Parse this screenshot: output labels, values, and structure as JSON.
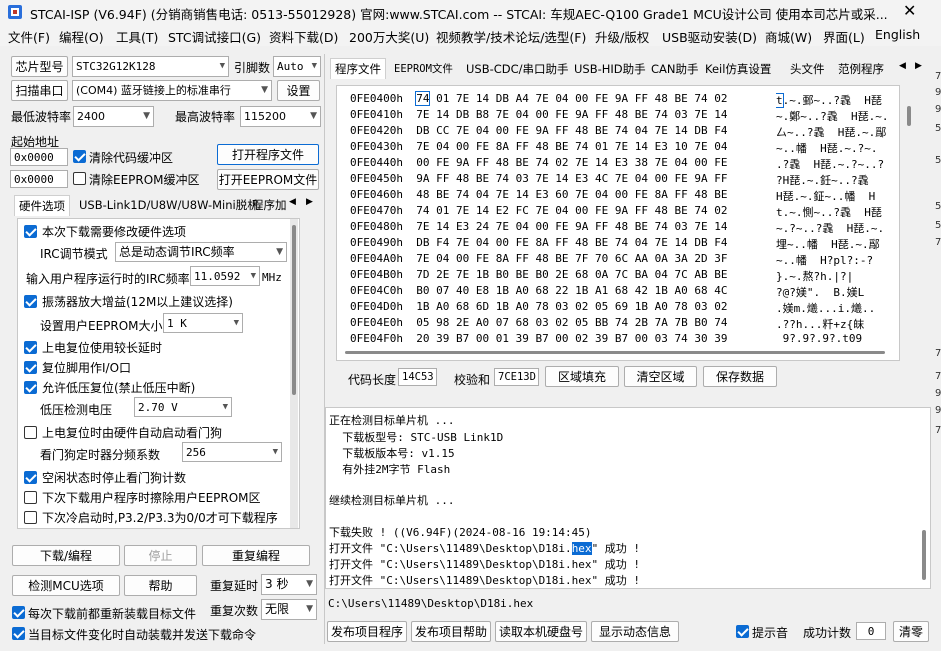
{
  "titlebar": {
    "title": "STCAI-ISP (V6.94F) (分销商销售电话: 0513-55012928) 官网:www.STCAI.com  -- STCAI: 车规AEC-Q100 Grade1 MCU设计公司 使用本司芯片或采...",
    "close": "✕"
  },
  "menu": [
    "文件(F)",
    "编程(O)",
    "工具(T)",
    "STC调试接口(G)",
    "资料下载(D)",
    "200万大奖(U)",
    "视频教学/技术论坛/选型(F)",
    "升级/版权",
    "USB驱动安装(D)",
    "商城(W)",
    "界面(L)",
    "English"
  ],
  "left": {
    "chip_label": "芯片型号",
    "chip_value": "STC32G12K128",
    "pin_label": "引脚数",
    "pin_value": "Auto",
    "scan_button": "扫描串口",
    "port_value": "(COM4) 蓝牙链接上的标准串行",
    "settings_button": "设置",
    "min_baud_label": "最低波特率",
    "min_baud_value": "2400",
    "max_baud_label": "最高波特率",
    "max_baud_value": "115200",
    "start_addr_label": "起始地址",
    "addr1": "0x0000",
    "clear_code": "清除代码缓冲区",
    "open_prog": "打开程序文件",
    "addr2": "0x0000",
    "clear_eeprom": "清除EEPROM缓冲区",
    "open_eeprom": "打开EEPROM文件",
    "tabs": [
      "硬件选项",
      "USB-Link1D/U8W/U8W-Mini脱机",
      "程序加"
    ],
    "options": {
      "opt1": "本次下载需要修改硬件选项",
      "irc_mode_label": "IRC调节模式",
      "irc_mode_value": "总是动态调节IRC频率",
      "irc_freq_label": "输入用户程序运行时的IRC频率",
      "irc_freq_value": "11.0592",
      "irc_unit": "MHz",
      "opt_osc": "振荡器放大增益(12M以上建议选择)",
      "eeprom_size_label": "设置用户EEPROM大小",
      "eeprom_size_value": "1  K",
      "opt_delay": "上电复位使用较长延时",
      "opt_reset_io": "复位脚用作I/O口",
      "opt_lvd": "允许低压复位(禁止低压中断)",
      "lvd_label": "低压检测电压",
      "lvd_value": "2.70 V",
      "opt_wdt": "上电复位时由硬件自动启动看门狗",
      "wdt_label": "看门狗定时器分频系数",
      "wdt_value": "256",
      "opt_idle": "空闲状态时停止看门狗计数",
      "opt_erase": "下次下载用户程序时擦除用户EEPROM区",
      "opt_p32": "下次冷启动时,P3.2/P3.3为0/0才可下载程序"
    },
    "download_button": "下载/编程",
    "stop_button": "停止",
    "reprogram_button": "重复编程",
    "detect_button": "检测MCU选项",
    "help_button": "帮助",
    "repeat_delay_label": "重复延时",
    "repeat_delay_value": "3 秒",
    "repeat_count_label": "重复次数",
    "repeat_count_value": "无限",
    "reload_check": "每次下载前都重新装载目标文件",
    "auto_check": "当目标文件变化时自动装载并发送下载命令"
  },
  "right": {
    "tabs": [
      "程序文件",
      "EEPROM文件",
      "USB-CDC/串口助手",
      "USB-HID助手",
      "CAN助手",
      "Keil仿真设置",
      "头文件",
      "范例程序"
    ],
    "hex_rows": [
      {
        "addr": "0FE0400h",
        "first": "74",
        "bytes": " 01 7E 14 DB A4 7E 04 00 FE 9A FF 48 BE 74 02",
        "ascii_first": "t",
        "ascii": ".~.鄄~..?毳  H琵"
      },
      {
        "addr": "0FE0410h",
        "first": "",
        "bytes": "7E 14 DB B8 7E 04 00 FE 9A FF 48 BE 74 03 7E 14",
        "ascii_first": "",
        "ascii": "~.鄭~..?毳  H琵.~."
      },
      {
        "addr": "0FE0420h",
        "first": "",
        "bytes": "DB CC 7E 04 00 FE 9A FF 48 BE 74 04 7E 14 DB F4",
        "ascii_first": "",
        "ascii": "厶~..?毳  H琵.~.鄬"
      },
      {
        "addr": "0FE0430h",
        "first": "",
        "bytes": "7E 04 00 FE 8A FF 48 BE 74 01 7E 14 E3 10 7E 04",
        "ascii_first": "",
        "ascii": "~..幡  H琵.~.?~."
      },
      {
        "addr": "0FE0440h",
        "first": "",
        "bytes": "00 FE 9A FF 48 BE 74 02 7E 14 E3 38 7E 04 00 FE",
        "ascii_first": "",
        "ascii": ".?毳  H琵.~.?~..?"
      },
      {
        "addr": "0FE0450h",
        "first": "",
        "bytes": "9A FF 48 BE 74 03 7E 14 E3 4C 7E 04 00 FE 9A FF",
        "ascii_first": "",
        "ascii": "?H琵.~.鈓~..?毳"
      },
      {
        "addr": "0FE0460h",
        "first": "",
        "bytes": "48 BE 74 04 7E 14 E3 60 7E 04 00 FE 8A FF 48 BE",
        "ascii_first": "",
        "ascii": "H琵.~.鉦~..幡  H"
      },
      {
        "addr": "0FE0470h",
        "first": "",
        "bytes": "74 01 7E 14 E2 FC 7E 04 00 FE 9A FF 48 BE 74 02",
        "ascii_first": "",
        "ascii": "t.~.惻~..?毳  H琵"
      },
      {
        "addr": "0FE0480h",
        "first": "",
        "bytes": "7E 14 E3 24 7E 04 00 FE 9A FF 48 BE 74 03 7E 14",
        "ascii_first": "",
        "ascii": "~.?~..?毳  H琵.~."
      },
      {
        "addr": "0FE0490h",
        "first": "",
        "bytes": "DB F4 7E 04 00 FE 8A FF 48 BE 74 04 7E 14 DB F4",
        "ascii_first": "",
        "ascii": "埋~..幡  H琵.~.鄬"
      },
      {
        "addr": "0FE04A0h",
        "first": "",
        "bytes": "7E 04 00 FE 8A FF 48 BE 7F 70 6C AA 0A 3A 2D 3F",
        "ascii_first": "",
        "ascii": "~..幡  H?pl?:-?"
      },
      {
        "addr": "0FE04B0h",
        "first": "",
        "bytes": "7D 2E 7E 1B B0 BE B0 2E 68 0A 7C BA 04 7C AB BE",
        "ascii_first": "",
        "ascii": "}.~.熬?h.|?|"
      },
      {
        "addr": "0FE04C0h",
        "first": "",
        "bytes": "B0 07 40 E8 1B A0 68 22 1B A1 68 42 1B A0 68 4C",
        "ascii_first": "",
        "ascii": "?@?媄\".  B.媄L"
      },
      {
        "addr": "0FE04D0h",
        "first": "",
        "bytes": "1B A0 68 6D 1B A0 78 03 02 05 69 1B A0 78 03 02",
        "ascii_first": "",
        "ascii": ".媄m.爔...i.爔.."
      },
      {
        "addr": "0FE04E0h",
        "first": "",
        "bytes": "05 98 2E A0 07 68 03 02 05 BB 74 2B 7A 7B B0 74",
        "ascii_first": "",
        "ascii": ".??h...粁+z{皌"
      },
      {
        "addr": "0FE04F0h",
        "first": "",
        "bytes": "20 39 B7 00 01 39 B7 00 02 39 B7 00 03 74 30 39",
        "ascii_first": "",
        "ascii": " 9?.9?.9?.t09"
      }
    ],
    "code_len_label": "代码长度",
    "code_len_value": "14C53",
    "checksum_label": "校验和",
    "checksum_value": "7CE13D",
    "fill_button": "区域填充",
    "clear_button": "清空区域",
    "save_button": "保存数据",
    "log": [
      "正在检测目标单片机 ...",
      "  下载板型号: STC-USB Link1D",
      "  下载板版本号: v1.15",
      "  有外挂2M字节 Flash",
      "",
      "继续检测目标单片机 ...",
      "",
      "下载失败 ! ((V6.94F)(2024-08-16 19:14:45)"
    ],
    "log_open1_a": "打开文件 \"C:\\Users\\11489\\Desktop\\D18i.",
    "log_open1_hl": "hex",
    "log_open1_b": "\" 成功 !",
    "log_open2": "打开文件 \"C:\\Users\\11489\\Desktop\\D18i.hex\" 成功 !",
    "log_open3": "打开文件 \"C:\\Users\\11489\\Desktop\\D18i.hex\" 成功 !",
    "path": "C:\\Users\\11489\\Desktop\\D18i.hex",
    "publish_prog": "发布项目程序",
    "publish_help": "发布项目帮助",
    "read_disk": "读取本机硬盘号",
    "show_dynamic": "显示动态信息",
    "beep_label": "提示音",
    "success_label": "成功计数",
    "success_value": "0",
    "clear_count": "清零"
  },
  "edge_digits": [
    "7",
    "9",
    "9",
    "5",
    "5",
    "5",
    "5",
    "7",
    "7",
    "7",
    "9",
    "9",
    "7"
  ],
  "colors": {
    "accent": "#0b6bd3",
    "highlight": "#0b6bd3"
  }
}
